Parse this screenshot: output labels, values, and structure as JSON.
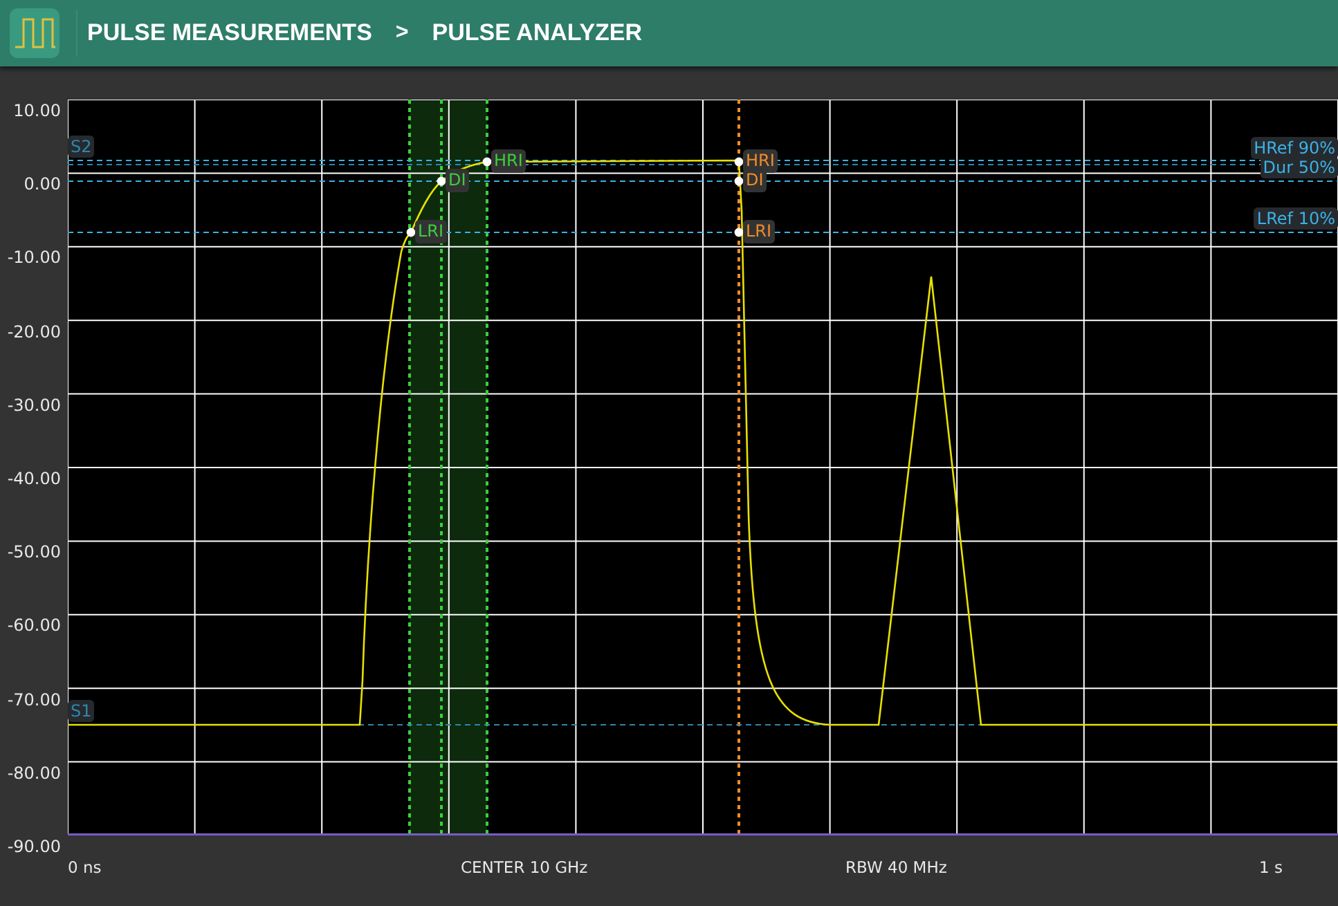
{
  "header": {
    "breadcrumb": [
      {
        "label": "PULSE MEASUREMENTS"
      },
      {
        "label": "PULSE ANALYZER"
      }
    ],
    "separator": ">"
  },
  "y_axis": {
    "labels": [
      "10.00",
      "0.00",
      "-10.00",
      "-20.00",
      "-30.00",
      "-40.00",
      "-50.00",
      "-60.00",
      "-70.00",
      "-80.00",
      "-90.00"
    ]
  },
  "plot": {
    "ref_lines": [
      {
        "label": "S2",
        "kind": "source"
      },
      {
        "label": "HRef 90%",
        "kind": "reference"
      },
      {
        "label": "Dur 50%",
        "kind": "reference"
      },
      {
        "label": "LRef 10%",
        "kind": "reference"
      },
      {
        "label": "S1",
        "kind": "source"
      }
    ],
    "marker_groups": [
      {
        "color": "#3ccf3c",
        "markers": [
          "LRI",
          "DI",
          "HRI"
        ]
      },
      {
        "color": "#f08c2a",
        "markers": [
          "HRI",
          "DI",
          "LRI"
        ]
      }
    ]
  },
  "x_axis": {
    "labels": [
      "0 ns",
      "CENTER 10 GHz",
      "RBW 40 MHz",
      "1 s"
    ]
  }
}
